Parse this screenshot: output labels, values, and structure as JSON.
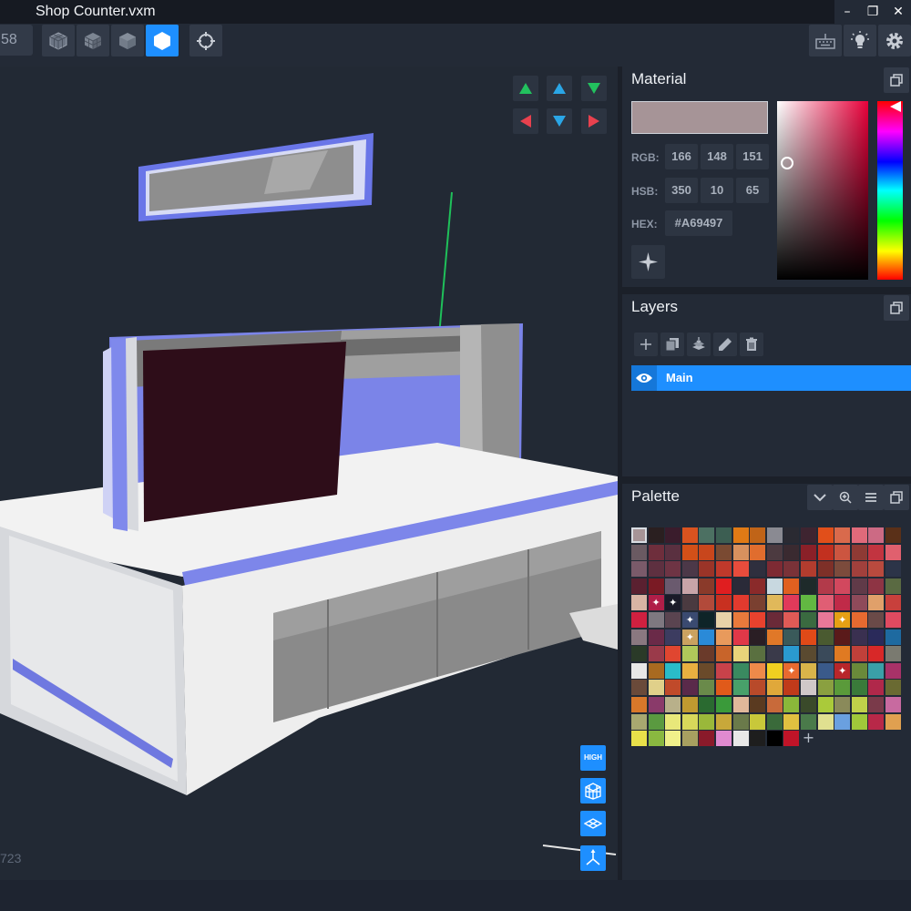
{
  "window": {
    "title": "Shop Counter.vxm",
    "minimize_glyph": "–",
    "restore_glyph": "❐",
    "close_glyph": "✕"
  },
  "toolbar": {
    "frame_counter": "58",
    "render_modes": [
      {
        "icon": "wireframe-cube-icon",
        "active": false
      },
      {
        "icon": "shaded-cube-icon",
        "active": false
      },
      {
        "icon": "solid-cube-icon",
        "active": false
      },
      {
        "icon": "hexagon-icon",
        "active": true
      }
    ],
    "focus_icon": "crosshair-icon",
    "right_tools": [
      "keyboard-icon",
      "light-bulb-icon",
      "gear-icon"
    ]
  },
  "viewport": {
    "nav_arrows": [
      {
        "dir": "up",
        "color": "#22c15e"
      },
      {
        "dir": "up",
        "color": "#2aa6e6"
      },
      {
        "dir": "down",
        "color": "#22c15e"
      },
      {
        "dir": "left",
        "color": "#e8414e"
      },
      {
        "dir": "down",
        "color": "#2aa6e6"
      },
      {
        "dir": "right",
        "color": "#e8414e"
      }
    ],
    "quality_label": "HIGH",
    "side_tools": [
      "grid-box-icon",
      "ground-plane-icon",
      "axes-icon"
    ],
    "bottom_counter": "723"
  },
  "material": {
    "title": "Material",
    "color": "#A69497",
    "rgb_label": "RGB:",
    "rgb": [
      "166",
      "148",
      "151"
    ],
    "hsb_label": "HSB:",
    "hsb": [
      "350",
      "10",
      "65"
    ],
    "hex_label": "HEX:",
    "hex": "#A69497",
    "picker_icon": "sparkle-icon"
  },
  "layers": {
    "title": "Layers",
    "tools": [
      "add-icon",
      "duplicate-icon",
      "merge-down-icon",
      "rename-icon",
      "trash-icon"
    ],
    "items": [
      {
        "name": "Main",
        "visible": true,
        "selected": true
      }
    ]
  },
  "palette": {
    "title": "Palette",
    "tools": [
      "chevron-down-icon",
      "zoom-icon",
      "menu-icon",
      "popout-icon"
    ],
    "add_glyph": "+",
    "colors": [
      "#a69497",
      "#2a1f20",
      "#3a1c2c",
      "#d9531f",
      "#4c7062",
      "#3c5e52",
      "#e07a15",
      "#c06418",
      "#8a8a92",
      "#2a2a32",
      "#3e2430",
      "#e14f1a",
      "#d96a4c",
      "#e06a7a",
      "#cc6a84",
      "#5a3018",
      "#6a5a62",
      "#6e2e3c",
      "#5a3040",
      "#d35018",
      "#c8461c",
      "#7a4a32",
      "#d8915e",
      "#e06d2e",
      "#4c3a40",
      "#3a2a30",
      "#8a2028",
      "#c2301f",
      "#cc5540",
      "#8e3a34",
      "#c23440",
      "#e0606e",
      "#7a5a6a",
      "#5e3040",
      "#6e3444",
      "#4c3848",
      "#9a3428",
      "#c0392b",
      "#e84c3c",
      "#2f2f3e",
      "#7e2a33",
      "#7a3238",
      "#b23c2e",
      "#7e3028",
      "#7c4b3c",
      "#a1403c",
      "#b94a3e",
      "#2c3448",
      "#5a2030",
      "#7a1a24",
      "#6a5a6e",
      "#c8a4a8",
      "#8a3a2a",
      "#e01e20",
      "#2a2a38",
      "#8a2a2a",
      "#c8d8e0",
      "#e06020",
      "#1e2a2a",
      "#b23a4a",
      "#d2485e",
      "#603a48",
      "#8e3444",
      "#5a6a42",
      "#d8b4a4",
      "#b01e48",
      "#1a1a28",
      "#4a3a40",
      "#b24a3a",
      "#c83020",
      "#e23a2e",
      "#7a4030",
      "#e0b85a",
      "#e03a5a",
      "#62b842",
      "#e05e74",
      "#c02a48",
      "#8e4a5a",
      "#e0a06a",
      "#c8403c",
      "#d02040",
      "#7e7880",
      "#5a4450",
      "#3a4a70",
      "#0e2428",
      "#e8d2a8",
      "#e87a3c",
      "#e8422e",
      "#6a2a38",
      "#e05a56",
      "#3a6a40",
      "#e87898",
      "#e6a014",
      "#e66a30",
      "#6a4a48",
      "#e04a60",
      "#8a7880",
      "#6a2a48",
      "#3c3c60",
      "#caa260",
      "#2a8ad8",
      "#e89a5c",
      "#e03848",
      "#2a1e24",
      "#e07828",
      "#3a5a5a",
      "#e04a18",
      "#4a5a30",
      "#5a1a1a",
      "#3a3050",
      "#2a2a5a",
      "#1e6aa0",
      "#2a3a28",
      "#9a3a4a",
      "#e04630",
      "#b0c85a",
      "#6a3a2a",
      "#c8642a",
      "#e8d47a",
      "#5a7040",
      "#3a3a4a",
      "#2a9ad0",
      "#5a4a30",
      "#3a4a5a",
      "#e07a22",
      "#c0403a",
      "#d82828",
      "#7a7a70",
      "#e8e8e8",
      "#a86a20",
      "#2abcc8",
      "#e8b040",
      "#6a4a2a",
      "#c8424a",
      "#3a8a60",
      "#ee8a4a",
      "#f0d020",
      "#e86a30",
      "#d8b44a",
      "#3a5a8a",
      "#b8262a",
      "#6a8a3a",
      "#3aa0a8",
      "#a83268",
      "#6a4a3a",
      "#e0d08a",
      "#c04a2a",
      "#5a2a4a",
      "#6a8a4a",
      "#e05a1a",
      "#48a06a",
      "#b84a2a",
      "#e0a83a",
      "#c03a1a",
      "#d0c8c8",
      "#8aa040",
      "#5a9a3a",
      "#3a7a3a",
      "#b0284a",
      "#6a6a32",
      "#d8782a",
      "#8a3a6a",
      "#b8b08a",
      "#c09a30",
      "#2a6a30",
      "#3a9a3a",
      "#e0b89a",
      "#5a3a20",
      "#c86a3a",
      "#8ab83a",
      "#3a4a2a",
      "#aaca3a",
      "#8a8a5a",
      "#c0d04a",
      "#7a3a4a",
      "#c86aa0",
      "#a8a870",
      "#5a9a40",
      "#e8e87a",
      "#d8d85a",
      "#9ab83a",
      "#c8a83a",
      "#6a7a4a",
      "#c8c83a",
      "#3a6a3a",
      "#e0c040",
      "#4a7a4a",
      "#e0e090",
      "#6aa0e0",
      "#a0c83a",
      "#b82848",
      "#e0a050",
      "#e8e04a",
      "#8ab840",
      "#f0f08a",
      "#a8a060",
      "#8a1a2a",
      "#e08ad0",
      "#e8e8e8",
      "#1e1e1e",
      "#000000",
      "#c01428"
    ],
    "marked": [
      65,
      66,
      83,
      92,
      137,
      140,
      99
    ]
  }
}
